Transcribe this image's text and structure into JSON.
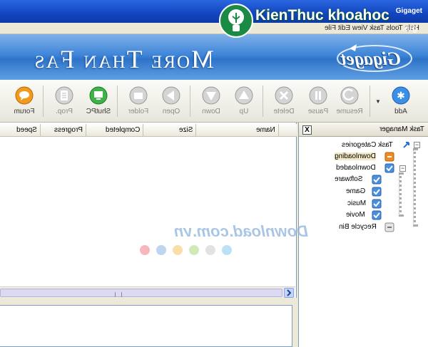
{
  "window": {
    "title": "Gigaget",
    "menu_hint": "Help  Tools  Task  View  Edit  File"
  },
  "banner": {
    "slogan": "More Than Fas",
    "logo": "Gigaget"
  },
  "toolbar": {
    "buttons": [
      {
        "label": "Add",
        "icon": "add-icon",
        "enabled": true
      },
      {
        "label": "Resume",
        "icon": "resume-icon",
        "enabled": false
      },
      {
        "label": "Pause",
        "icon": "pause-icon",
        "enabled": false
      },
      {
        "label": "Delete",
        "icon": "delete-icon",
        "enabled": false
      },
      {
        "label": "Up",
        "icon": "up-icon",
        "enabled": false
      },
      {
        "label": "Down",
        "icon": "down-icon",
        "enabled": false
      },
      {
        "label": "Open",
        "icon": "open-icon",
        "enabled": false
      },
      {
        "label": "Folder",
        "icon": "folder-icon",
        "enabled": false
      },
      {
        "label": "ShutPC",
        "icon": "shutpc-icon",
        "enabled": true
      },
      {
        "label": "Prop.",
        "icon": "properties-icon",
        "enabled": false
      },
      {
        "label": "Forum",
        "icon": "forum-icon",
        "enabled": true
      }
    ]
  },
  "task_manager": {
    "title": "Task Manager",
    "close": "X",
    "tree": {
      "root": "Task Categories",
      "downloading": "Downloading",
      "downloaded": "Downloaded",
      "software": "Software",
      "game": "Game",
      "music": "Music",
      "movie": "Movie",
      "recycle_bin": "Recycle Bin"
    }
  },
  "list": {
    "columns": [
      "Name",
      "Size",
      "Completed",
      "Progress",
      "Speed"
    ]
  },
  "watermark": {
    "text": "Download.com.vn"
  },
  "overlay": {
    "brand": "KienThuc khoahoc",
    "tld": ".org"
  },
  "colors": {
    "title_blue": "#1245c0",
    "banner_blue": "#3f86d9",
    "tree_icon_blue": "#4a8fe0",
    "downloading_orange": "#f08a24"
  }
}
